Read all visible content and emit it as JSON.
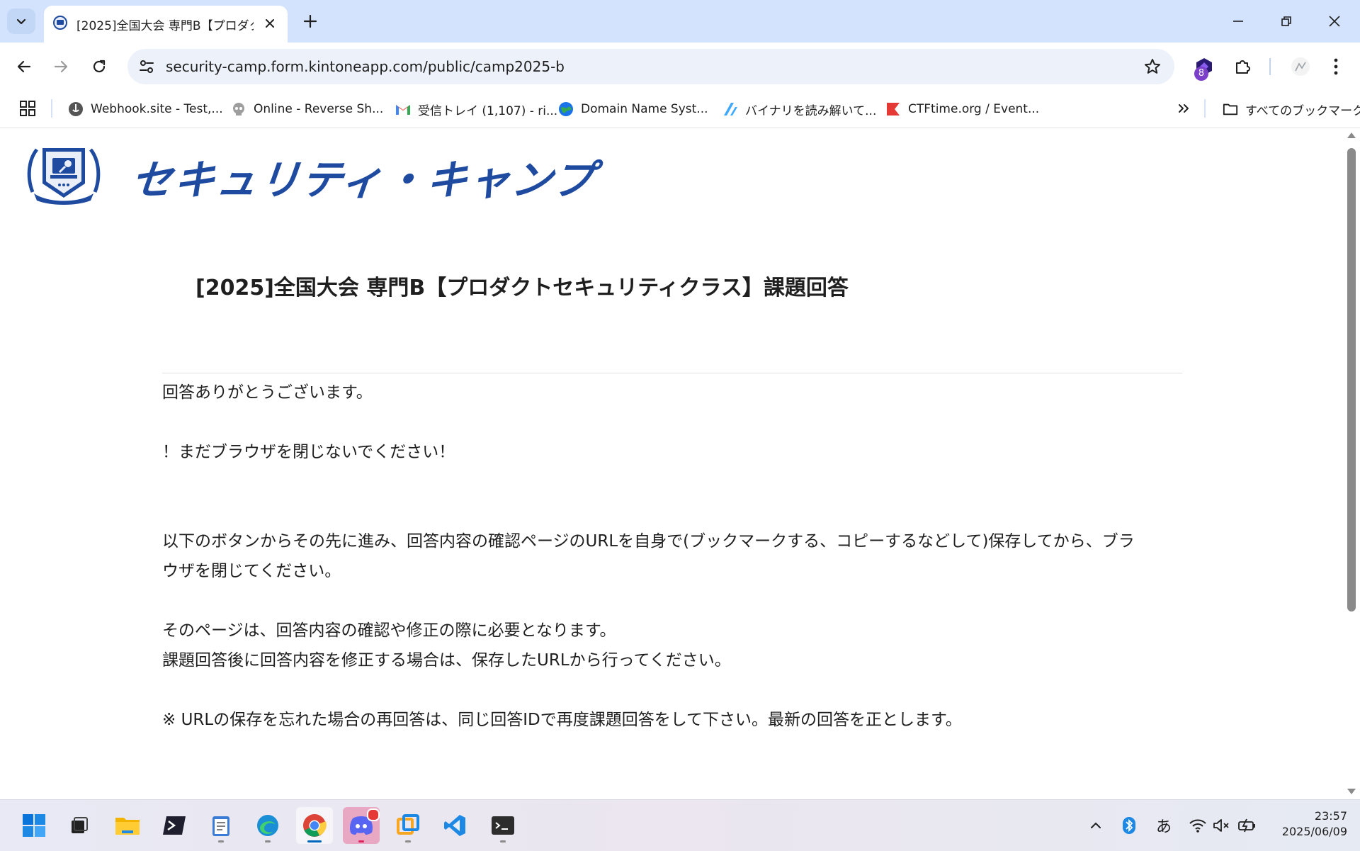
{
  "browser": {
    "tab_title": "[2025]全国大会 専門B【プロダクト",
    "url": "security-camp.form.kintoneapp.com/public/camp2025-b",
    "extension_badge": "8"
  },
  "bookmarks": [
    {
      "label": "Webhook.site - Test,...",
      "icon": "webhook-icon"
    },
    {
      "label": "Online - Reverse Sh...",
      "icon": "skull-icon"
    },
    {
      "label": "受信トレイ (1,107) - ri...",
      "icon": "gmail-icon"
    },
    {
      "label": "Domain Name Syst...",
      "icon": "globe-icon"
    },
    {
      "label": "バイナリを読み解いて...",
      "icon": "zenn-icon"
    },
    {
      "label": "CTFtime.org / Event...",
      "icon": "ctftime-icon"
    }
  ],
  "all_bookmarks_label": "すべてのブックマーク",
  "page": {
    "logo_text": "セキュリティ・キャンプ",
    "title": "[2025]全国大会 専門B【プロダクトセキュリティクラス】課題回答",
    "paragraphs": {
      "thanks": "回答ありがとうございます。",
      "warning": "！まだブラウザを閉じないでください！",
      "instruction_line1": "以下のボタンからその先に進み、回答内容の確認ページのURLを自身で(ブックマークする、コピーするなどして)保存してから、ブラ",
      "instruction_line2": "ウザを閉じてください。",
      "note_line1": "そのページは、回答内容の確認や修正の際に必要となります。",
      "note_line2": "課題回答後に回答内容を修正する場合は、保存したURLから行ってください。",
      "footnote": "※ URLの保存を忘れた場合の再回答は、同じ回答IDで再度課題回答をして下さい。最新の回答を正とします。"
    }
  },
  "taskbar": {
    "ime_label": "あ",
    "time": "23:57",
    "date": "2025/06/09"
  },
  "colors": {
    "tabstrip": "#d3e3fd",
    "omnibox": "#edf2fa",
    "logo_blue": "#1e4aa0"
  }
}
